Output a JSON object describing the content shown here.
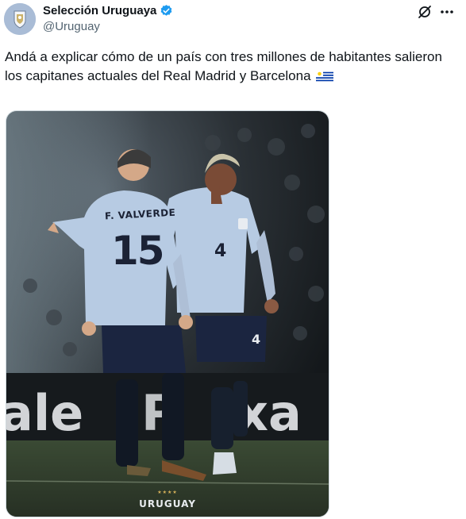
{
  "author": {
    "display_name": "Selección Uruguaya",
    "handle": "@Uruguay",
    "verified": true,
    "avatar_icon": "uruguay-crest-icon"
  },
  "actions": {
    "grok_icon": "grok-slash-icon",
    "more_icon": "more-horizontal-icon"
  },
  "tweet": {
    "text": "Andá a explicar cómo de un país con tres millones de habitantes salieron los capitanes actuales del Real Madrid y Barcelona",
    "emoji": "uruguay-flag"
  },
  "media": {
    "jersey_name": "F. VALVERDE",
    "jersey_number_back": "15",
    "jersey_number_front": "4",
    "shorts_number": "4",
    "stars": "★★★★",
    "brand_word": "URUGUAY"
  },
  "colors": {
    "verified": "#1d9bf0",
    "jersey": "#b7cbe3",
    "navy": "#1b2235"
  }
}
